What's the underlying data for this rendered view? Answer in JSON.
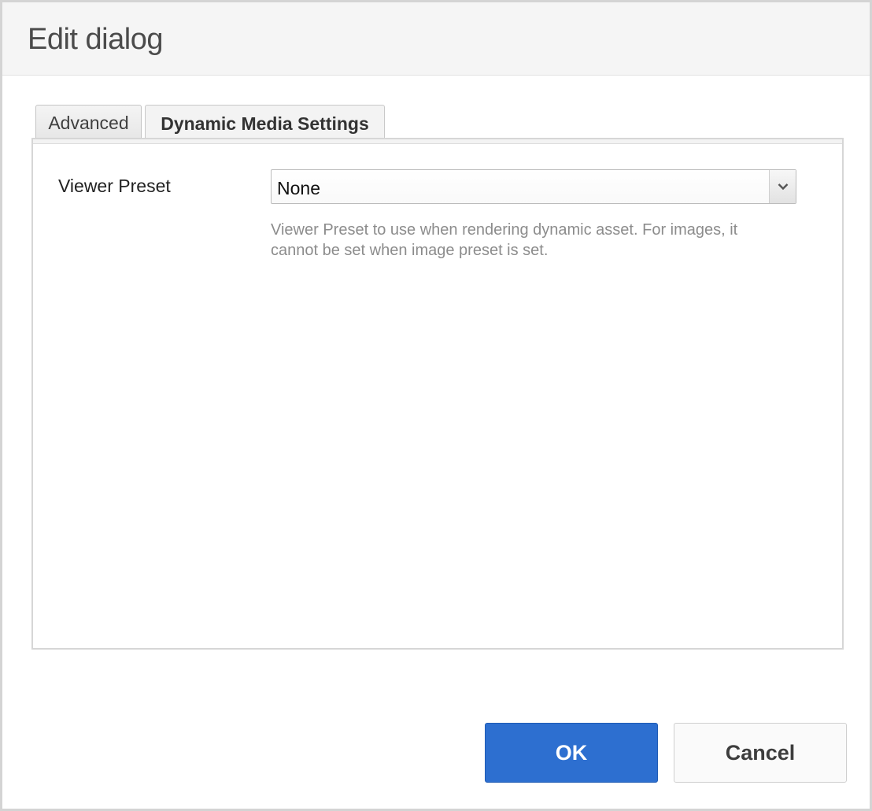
{
  "dialog": {
    "title": "Edit dialog"
  },
  "tabs": [
    {
      "label": "Advanced",
      "active": false
    },
    {
      "label": "Dynamic Media Settings",
      "active": true
    }
  ],
  "form": {
    "viewer_preset": {
      "label": "Viewer Preset",
      "value": "None",
      "help_text": "Viewer Preset to use when rendering dynamic asset. For images, it cannot be set when image preset is set."
    }
  },
  "actions": {
    "ok_label": "OK",
    "cancel_label": "Cancel"
  },
  "colors": {
    "primary_button": "#2d6fd0",
    "help_text": "#8c8c8c"
  },
  "icons": {
    "dropdown": "chevron-down-icon"
  }
}
